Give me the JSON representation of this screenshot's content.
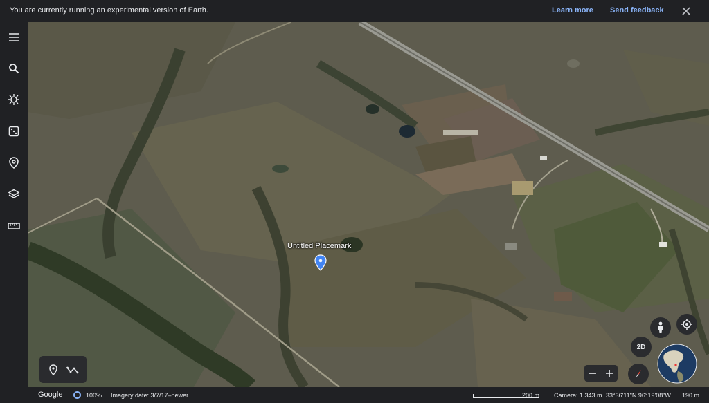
{
  "banner": {
    "message": "You are currently running an experimental version of Earth.",
    "learn_more": "Learn more",
    "send_feedback": "Send feedback"
  },
  "rail": {
    "icons": [
      "menu-icon",
      "search-icon",
      "voyager-icon",
      "dice-icon",
      "projects-icon",
      "map-style-icon",
      "ruler-icon"
    ]
  },
  "map": {
    "placemark_label": "Untitled Placemark"
  },
  "controls": {
    "two_d_label": "2D"
  },
  "status": {
    "brand": "Google",
    "streaming_percent": "100%",
    "imagery_date": "Imagery date: 3/7/17–newer",
    "scale": "200 m",
    "camera": "Camera: 1,343 m",
    "coordinates": "33°36'11\"N 96°19'08\"W",
    "altitude": "190 m"
  },
  "colors": {
    "banner_bg": "#202124",
    "link": "#8ab4f8",
    "pin": "#4285f4"
  }
}
